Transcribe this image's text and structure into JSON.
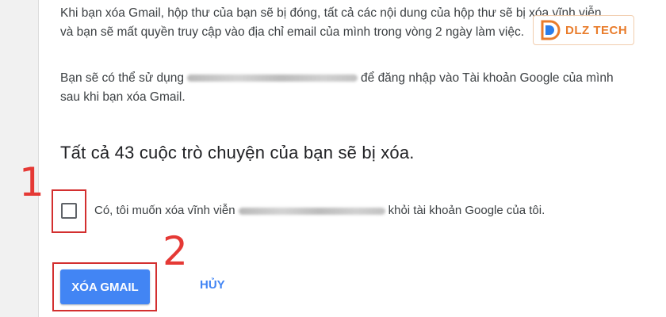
{
  "dialog": {
    "paragraph1": "Khi bạn xóa Gmail, hộp thư của bạn sẽ bị đóng, tất cả các nội dung của hộp thư sẽ bị xóa vĩnh viễn và bạn sẽ mất quyền truy cập vào địa chỉ email của mình trong vòng 2 ngày làm việc.",
    "paragraph2_before": "Bạn sẽ có thể sử dụng",
    "paragraph2_after": "để đăng nhập vào Tài khoản Google của mình sau khi bạn xóa Gmail.",
    "heading": "Tất cả 43 cuộc trò chuyện của bạn sẽ bị xóa.",
    "checkbox": {
      "checked": false,
      "label_before": "Có, tôi muốn xóa vĩnh viễn",
      "label_after": "khỏi tài khoản Google của tôi."
    },
    "primary_button": "XÓA GMAIL",
    "cancel_button": "HỦY"
  },
  "annotations": {
    "step1": "1",
    "step2": "2",
    "highlight_color": "#d32f2f"
  },
  "watermark": {
    "text": "DLZ TECH",
    "icon": "dlz-logo-icon",
    "color": "#e8711a"
  },
  "colors": {
    "primary": "#4285f4",
    "text": "#3c4043"
  }
}
